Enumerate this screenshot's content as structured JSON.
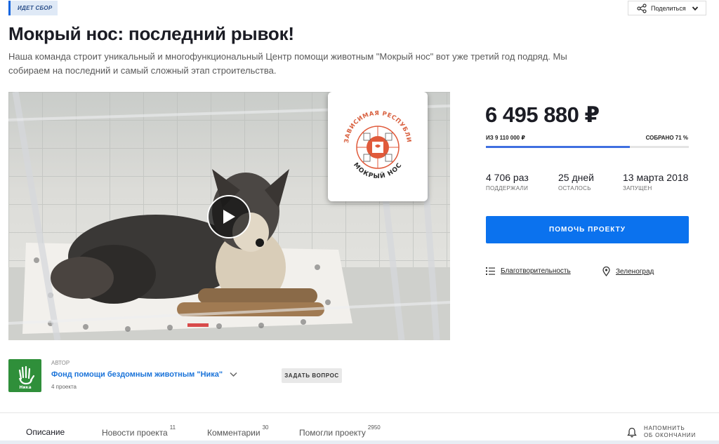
{
  "status_badge": "ИДЕТ СБОР",
  "share": {
    "label": "Поделиться",
    "icon": "share-icon"
  },
  "title": "Мокрый нос: последний рывок!",
  "description": "Наша команда строит уникальный и многофункциональный Центр помощи животным \"Мокрый нос\" вот уже третий год подряд. Мы собираем на последний и самый сложный этап строительства.",
  "media": {
    "logo_text_top": "НЕЗАВИСИМАЯ РЕСПУБЛИКА",
    "logo_text_bottom": "МОКРЫЙ НОС"
  },
  "funding": {
    "amount": "6 495 880 ₽",
    "goal": "ИЗ 9 110 000 ₽",
    "collected": "СОБРАНО 71 %",
    "progress_fraction": 0.71,
    "accent_color": "#3f6fe0"
  },
  "stats": [
    {
      "value": "4 706 раз",
      "caption": "ПОДДЕРЖАЛИ"
    },
    {
      "value": "25 дней",
      "caption": "ОСТАЛОСЬ"
    },
    {
      "value": "13 марта 2018",
      "caption": "ЗАПУЩЕН"
    }
  ],
  "help_button": "ПОМОЧЬ ПРОЕКТУ",
  "category": {
    "label": "Благотворительность",
    "icon": "list-icon"
  },
  "location": {
    "label": "Зеленоград",
    "icon": "map-pin-icon"
  },
  "author": {
    "caption": "АВТОР",
    "name": "Фонд помощи бездомным животным \"Ника\"",
    "projects": "4 проекта",
    "logo_text": "Ника",
    "ask_button": "ЗАДАТЬ ВОПРОС"
  },
  "tabs": [
    {
      "label": "Описание",
      "count": ""
    },
    {
      "label": "Новости проекта",
      "count": "11"
    },
    {
      "label": "Комментарии",
      "count": "30"
    },
    {
      "label": "Помогли проекту",
      "count": "2950"
    }
  ],
  "remind": {
    "line1": "НАПОМНИТЬ",
    "line2": "ОБ ОКОНЧАНИИ",
    "icon": "bell-icon"
  },
  "colors": {
    "button_blue": "#0b72ee",
    "link_blue": "#1a73d9",
    "badge_blue": "#1565e0"
  }
}
